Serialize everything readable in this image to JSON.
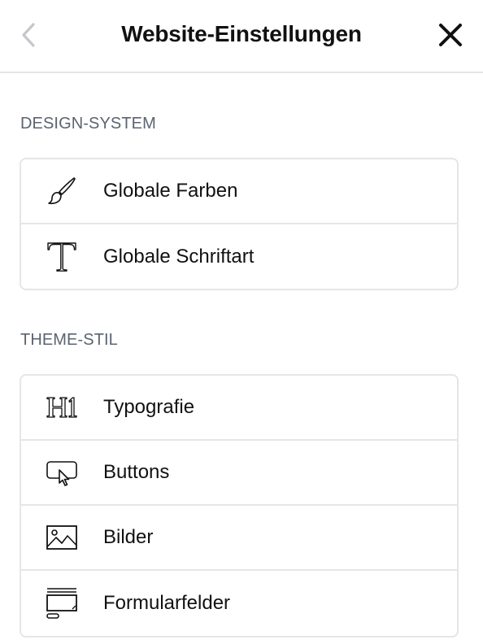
{
  "header": {
    "title": "Website-Einstellungen",
    "back_icon": "chevron-left-icon",
    "close_icon": "close-icon"
  },
  "sections": [
    {
      "label": "DESIGN-SYSTEM",
      "items": [
        {
          "label": "Globale Farben",
          "icon": "paintbrush-icon"
        },
        {
          "label": "Globale Schriftart",
          "icon": "serif-t-icon"
        }
      ]
    },
    {
      "label": "THEME-STIL",
      "items": [
        {
          "label": "Typografie",
          "icon": "h1-icon"
        },
        {
          "label": "Buttons",
          "icon": "button-cursor-icon"
        },
        {
          "label": "Bilder",
          "icon": "image-icon"
        },
        {
          "label": "Formularfelder",
          "icon": "form-field-icon"
        }
      ]
    }
  ],
  "colors": {
    "text": "#111111",
    "section_label": "#5b6470",
    "border": "#e4e6e8",
    "disabled_icon": "#c4c7cb"
  }
}
